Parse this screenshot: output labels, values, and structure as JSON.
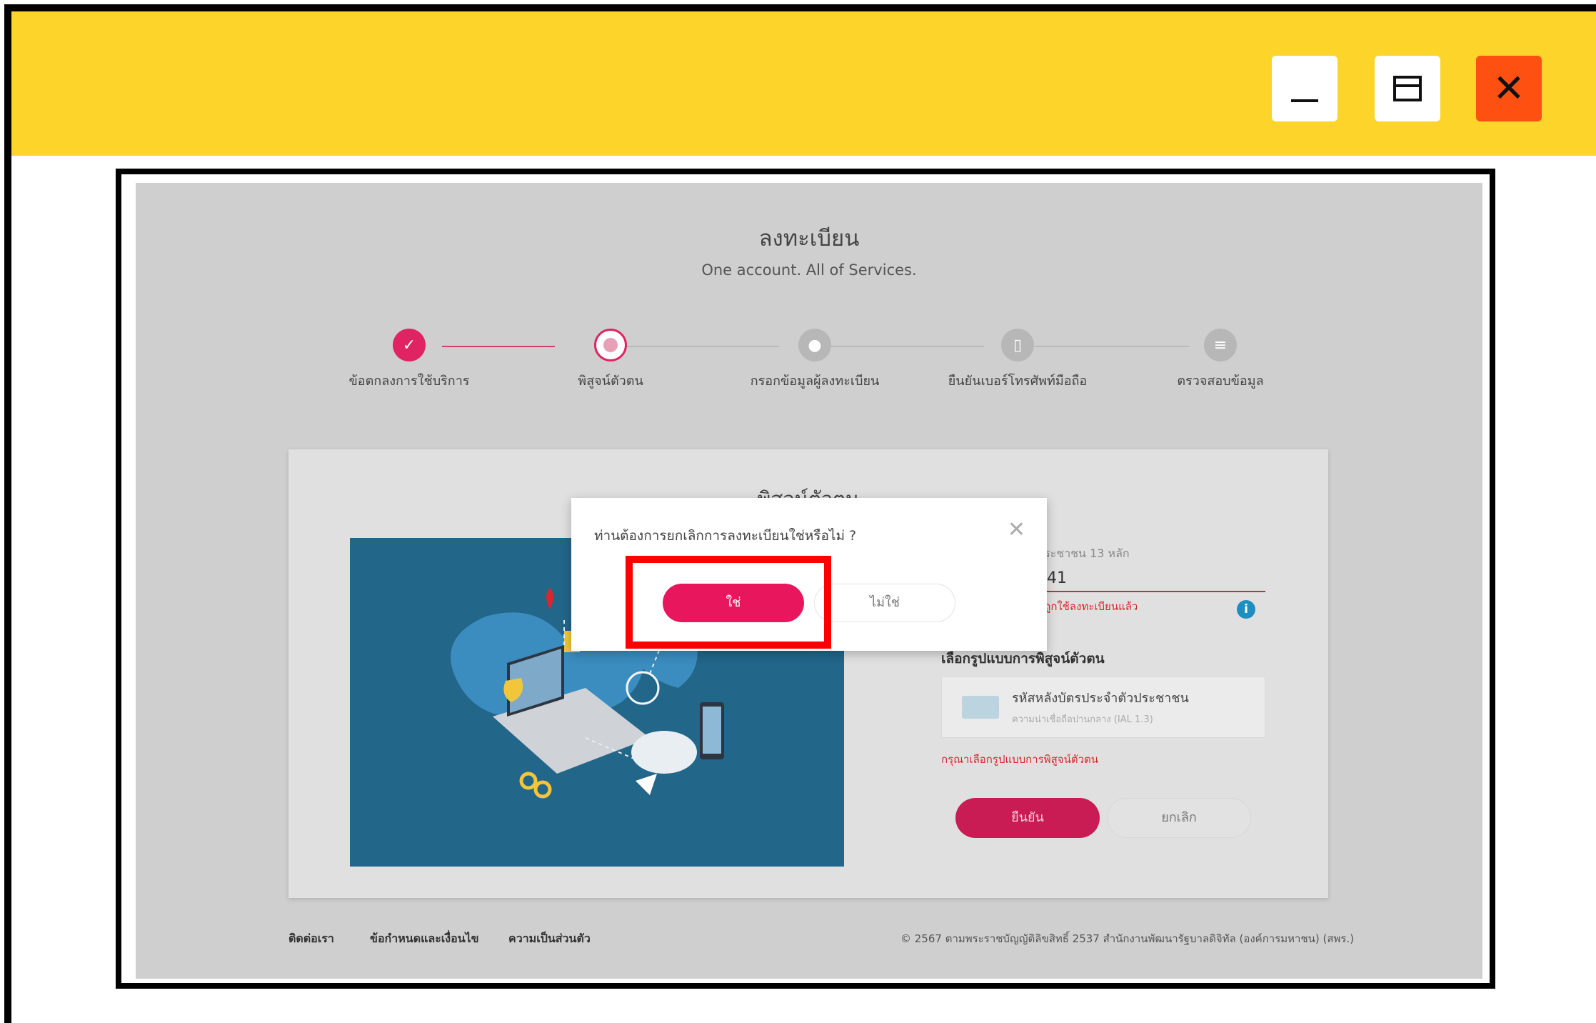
{
  "window": {
    "minimize_icon": "minimize-icon",
    "maximize_icon": "maximize-icon",
    "close_icon": "close-icon",
    "close_glyph": "✕",
    "titlebar_color": "#fdd42a",
    "close_color": "#fe5010"
  },
  "page": {
    "title": "ลงทะเบียน",
    "subtitle": "One account. All of Services."
  },
  "stepper": {
    "steps": [
      {
        "label": "ข้อตกลงการใช้บริการ",
        "state": "done",
        "icon": "check-icon"
      },
      {
        "label": "พิสูจน์ตัวตน",
        "state": "current",
        "icon": "fingerprint-icon"
      },
      {
        "label": "กรอกข้อมูลผู้ลงทะเบียน",
        "state": "todo",
        "icon": "user-icon"
      },
      {
        "label": "ยืนยันเบอร์โทรศัพท์มือถือ",
        "state": "todo",
        "icon": "phone-icon"
      },
      {
        "label": "ตรวจสอบข้อมูล",
        "state": "todo",
        "icon": "checklist-icon"
      }
    ],
    "accent": "#e02463"
  },
  "card": {
    "title": "พิสูจน์ตัวตน",
    "id_hint": "ประชาชน 13 หลัก",
    "id_value": "441",
    "id_error": "นี้ถูกใช้ลงทะเบียนแล้ว",
    "method_label": "เลือกรูปแบบการพิสูจน์ตัวตน",
    "method_title": "รหัสหลังบัตรประจำตัวประชาชน",
    "method_desc": "ความน่าเชื่อถือปานกลาง (IAL 1.3)",
    "method_warning": "กรุณาเลือกรูปแบบการพิสูจน์ตัวตน",
    "confirm_label": "ยืนยัน",
    "cancel_label": "ยกเลิก"
  },
  "footer": {
    "contact": "ติดต่อเรา",
    "terms": "ข้อกำหนดและเงื่อนไข",
    "privacy": "ความเป็นส่วนตัว",
    "copyright": "© 2567 ตามพระราชบัญญัติลิขสิทธิ์ 2537 สำนักงานพัฒนารัฐบาลดิจิทัล (องค์การมหาชน) (สพร.)"
  },
  "modal": {
    "question": "ท่านต้องการยกเลิกการลงทะเบียนใช่หรือไม่ ?",
    "yes_label": "ใช่",
    "no_label": "ไม่ใช่",
    "close_glyph": "✕"
  }
}
